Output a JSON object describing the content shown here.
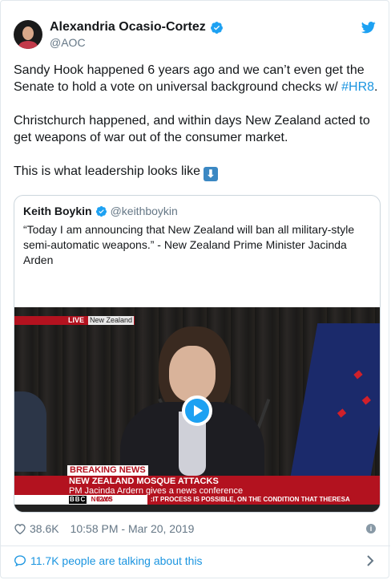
{
  "author": {
    "name": "Alexandria Ocasio-Cortez",
    "handle": "@AOC"
  },
  "tweet": {
    "paragraph1_text": "Sandy Hook happened 6 years ago and we can’t even get the Senate to hold a vote on universal background checks w/ ",
    "paragraph1_hashtag": "#HR8",
    "paragraph1_end": ".",
    "paragraph2": "Christchurch happened, and within days New Zealand acted to get weapons of war out of the consumer market.",
    "paragraph3": "This is what leadership looks like",
    "emoji": "⬇",
    "emoji_name": "down-arrow-emoji"
  },
  "quoted": {
    "name": "Keith Boykin",
    "handle": "@keithboykin",
    "text": "“Today I am announcing that New Zealand will ban all military-style semi-automatic weapons.” - New Zealand Prime Minister Jacinda Arden",
    "video": {
      "live_label": "LIVE",
      "location_label": "New Zealand",
      "breaking_label": "BREAKING NEWS",
      "headline": "NEW ZEALAND MOSQUE ATTACKS",
      "subheadline": "PM Jacinda Ardern gives a news conference",
      "channel_logo": "BBC",
      "channel_name": "NEWS",
      "time": "02:05",
      "ticker": ":IT PROCESS IS POSSIBLE, ON THE CONDITION THAT THERESA"
    }
  },
  "meta": {
    "likes": "38.6K",
    "timestamp": "10:58 PM - Mar 20, 2019",
    "talking": "11.7K people are talking about this"
  },
  "colors": {
    "link": "#1b95e0",
    "twitter_blue": "#1da1f2",
    "bbc_red": "#b3121f",
    "muted": "#657786"
  }
}
